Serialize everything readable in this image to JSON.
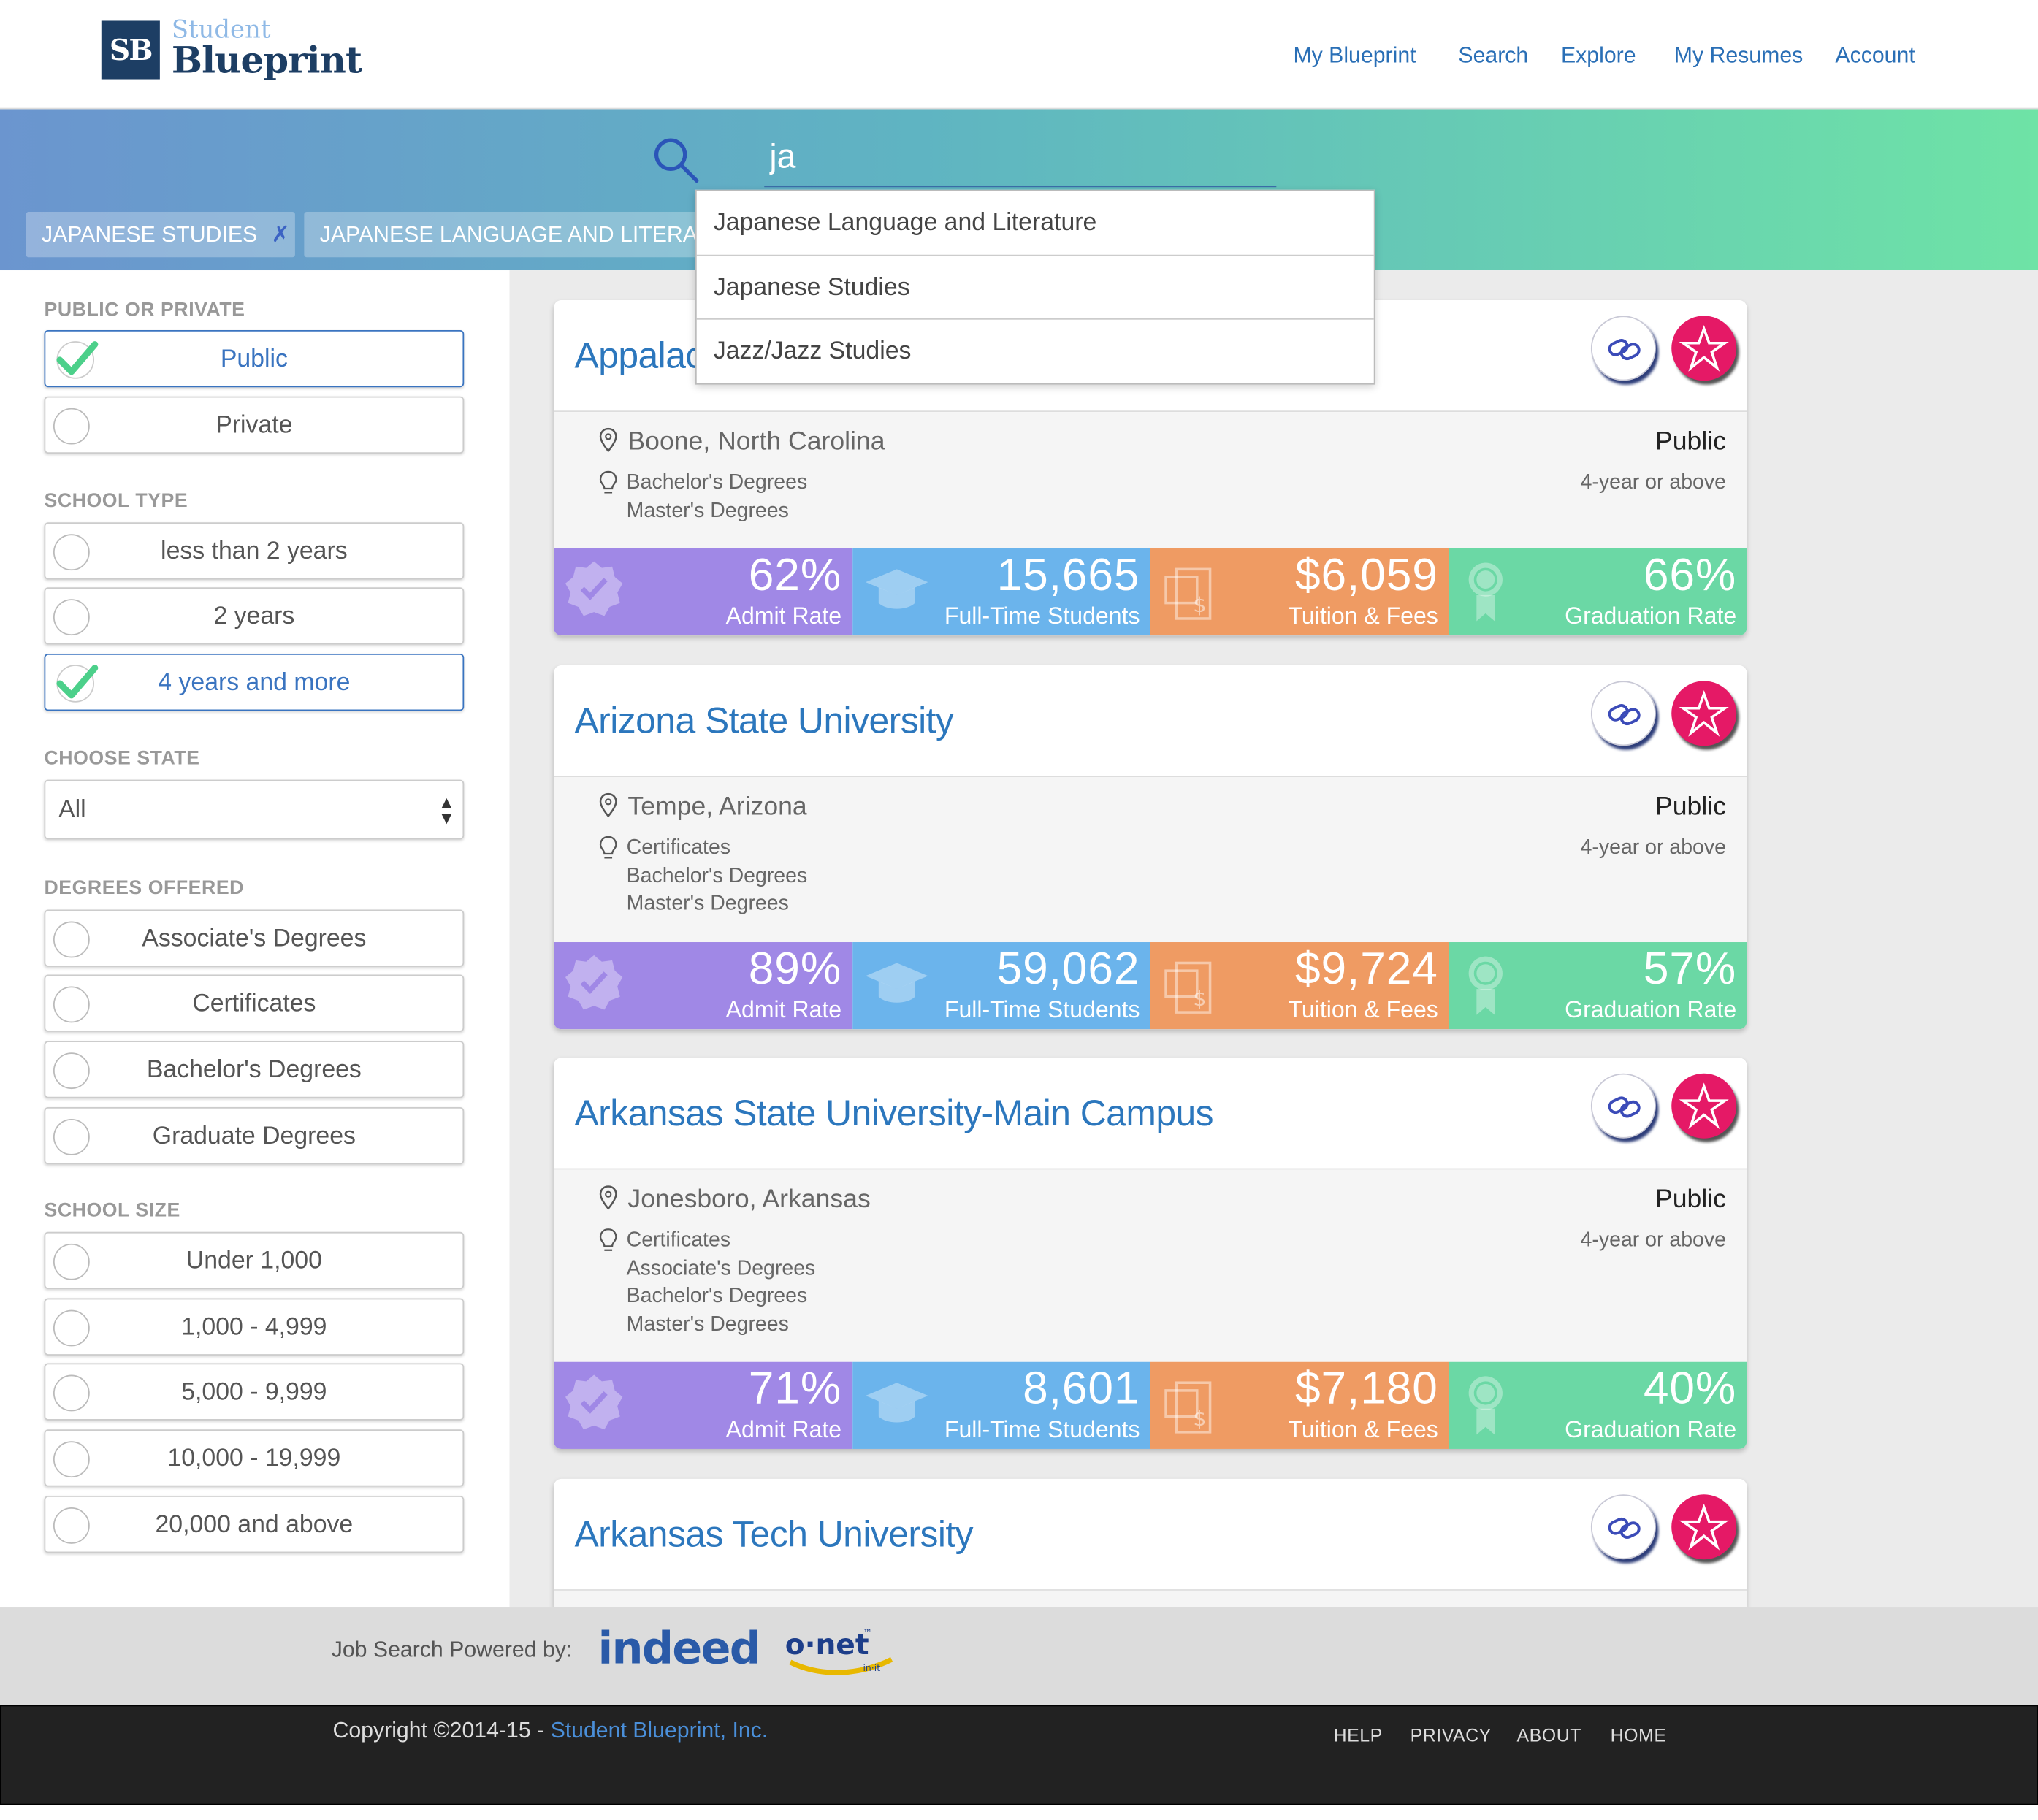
{
  "app": {
    "logo_mark": "SB",
    "logo_small": "Student",
    "logo_big": "Blueprint"
  },
  "nav": {
    "items": [
      "My Blueprint",
      "Search",
      "Explore",
      "My Resumes",
      "Account"
    ]
  },
  "search": {
    "value": "ja",
    "tags": [
      "JAPANESE STUDIES",
      "JAPANESE LANGUAGE AND LITERA"
    ],
    "tag_close": "✗",
    "suggestions": [
      "Japanese Language and Literature",
      "Japanese Studies",
      "Jazz/Jazz Studies"
    ]
  },
  "filters": {
    "public_private": {
      "label": "PUBLIC OR PRIVATE",
      "options": [
        {
          "label": "Public",
          "checked": true
        },
        {
          "label": "Private",
          "checked": false
        }
      ]
    },
    "school_type": {
      "label": "SCHOOL TYPE",
      "options": [
        {
          "label": "less than 2 years",
          "checked": false
        },
        {
          "label": "2 years",
          "checked": false
        },
        {
          "label": "4 years and more",
          "checked": true
        }
      ]
    },
    "state": {
      "label": "CHOOSE STATE",
      "value": "All"
    },
    "degrees": {
      "label": "DEGREES OFFERED",
      "options": [
        {
          "label": "Associate's Degrees",
          "checked": false
        },
        {
          "label": "Certificates",
          "checked": false
        },
        {
          "label": "Bachelor's Degrees",
          "checked": false
        },
        {
          "label": "Graduate Degrees",
          "checked": false
        }
      ]
    },
    "size": {
      "label": "SCHOOL SIZE",
      "options": [
        {
          "label": "Under 1,000",
          "checked": false
        },
        {
          "label": "1,000 - 4,999",
          "checked": false
        },
        {
          "label": "5,000 - 9,999",
          "checked": false
        },
        {
          "label": "10,000 - 19,999",
          "checked": false
        },
        {
          "label": "20,000 and above",
          "checked": false
        }
      ]
    }
  },
  "stat_labels": {
    "admit": "Admit Rate",
    "students": "Full-Time Students",
    "tuition": "Tuition & Fees",
    "grad": "Graduation Rate"
  },
  "results": [
    {
      "name": "Appalachian State University",
      "location": "Boone, North Carolina",
      "control": "Public",
      "level": "4-year or above",
      "degrees": [
        "Bachelor's Degrees",
        "Master's Degrees"
      ],
      "admit": "62%",
      "students": "15,665",
      "tuition": "$6,059",
      "grad": "66%"
    },
    {
      "name": "Arizona State University",
      "location": "Tempe, Arizona",
      "control": "Public",
      "level": "4-year or above",
      "degrees": [
        "Certificates",
        "Bachelor's Degrees",
        "Master's Degrees"
      ],
      "admit": "89%",
      "students": "59,062",
      "tuition": "$9,724",
      "grad": "57%"
    },
    {
      "name": "Arkansas State University-Main Campus",
      "location": "Jonesboro, Arkansas",
      "control": "Public",
      "level": "4-year or above",
      "degrees": [
        "Certificates",
        "Associate's Degrees",
        "Bachelor's Degrees",
        "Master's Degrees"
      ],
      "admit": "71%",
      "students": "8,601",
      "tuition": "$7,180",
      "grad": "40%"
    },
    {
      "name": "Arkansas Tech University"
    }
  ],
  "footer": {
    "powered": "Job Search Powered by:",
    "indeed": "indeed",
    "onet": "o·net",
    "onet_tm": "™",
    "onet_sub": "in·it",
    "copyright": "Copyright ©2014-15 - ",
    "company": "Student Blueprint, Inc.",
    "links": [
      "HELP",
      "PRIVACY",
      "ABOUT",
      "HOME"
    ]
  },
  "colors": {
    "admit": "#a088e6",
    "students": "#6bb4ec",
    "tuition": "#ef9b63",
    "grad": "#6bd8a5",
    "accent": "#2c77bd",
    "star": "#e51966"
  }
}
